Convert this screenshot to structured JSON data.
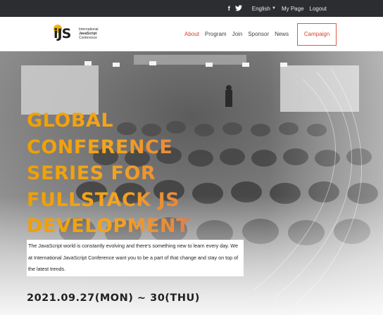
{
  "topbar": {
    "social": [
      {
        "icon": "facebook-icon",
        "glyph": "f"
      },
      {
        "icon": "twitter-icon",
        "glyph": "🐦"
      }
    ],
    "language": "English",
    "my_page": "My Page",
    "logout": "Logout"
  },
  "logo": {
    "mark": "iJS",
    "line1": "International",
    "line2": "JavaScript",
    "line3": "Conference"
  },
  "nav": {
    "items": [
      {
        "label": "About",
        "active": true
      },
      {
        "label": "Program",
        "active": false
      },
      {
        "label": "Join",
        "active": false
      },
      {
        "label": "Sponsor",
        "active": false
      },
      {
        "label": "News",
        "active": false
      }
    ],
    "campaign": "Campaign"
  },
  "hero": {
    "headline": [
      "GLOBAL",
      "CONFERENCE",
      "SERIES FOR",
      "FULLSTACK JS",
      "DEVELOPMENT"
    ],
    "description": "The JavaScript world is constantly evolving and there's something new to learn every day. We at International JavaScript Conference want you to be a part of that change and stay on top of the latest trends.",
    "date": "2021.09.27(MON) ~ 30(THU)"
  },
  "colors": {
    "topbar_bg": "#2b2d31",
    "accent": "#d9412b",
    "headline_gradient_start": "#f0a000",
    "headline_gradient_end": "#e25c5c",
    "logo_dot": "#f2b400"
  }
}
